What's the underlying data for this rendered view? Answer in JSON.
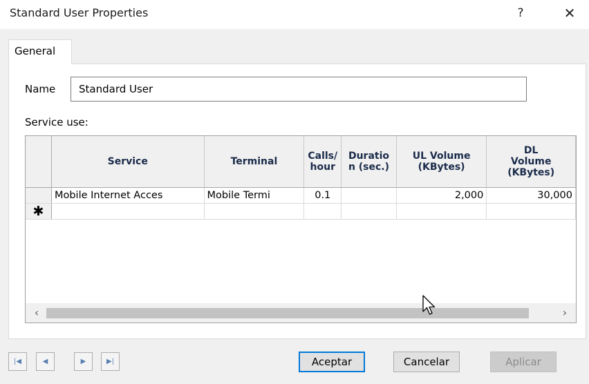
{
  "window": {
    "title": "Standard User Properties",
    "help_label": "?",
    "close_label": "✕"
  },
  "tabs": [
    {
      "label": "General",
      "selected": true
    }
  ],
  "name_field": {
    "label": "Name",
    "value": "Standard User"
  },
  "service_use": {
    "label": "Service use:",
    "columns": [
      {
        "key": "service",
        "label": "Service"
      },
      {
        "key": "terminal",
        "label": "Terminal"
      },
      {
        "key": "calls_hour",
        "label": "Calls/ hour"
      },
      {
        "key": "duration",
        "label": "Duratio n (sec.)"
      },
      {
        "key": "ul_volume",
        "label": "UL Volume (KBytes)"
      },
      {
        "key": "dl_volume",
        "label": "DL Volume (KBytes)"
      }
    ],
    "rows": [
      {
        "service": "Mobile Internet Acces",
        "terminal": "Mobile Termi",
        "calls_hour": "0.1",
        "duration": "",
        "ul_volume": "2,000",
        "dl_volume": "30,000"
      }
    ],
    "new_row_marker": "✱",
    "scroll_left_icon": "‹",
    "scroll_right_icon": "›"
  },
  "navigator": {
    "first_icon": "|◀",
    "prev_icon": "◀",
    "next_icon": "▶",
    "last_icon": "▶|"
  },
  "buttons": {
    "ok": "Aceptar",
    "cancel": "Cancelar",
    "apply": "Aplicar",
    "apply_enabled": false
  },
  "colors": {
    "accent": "#0078d7",
    "header_text": "#1a2b4a",
    "navigator_icon": "#5a7fb0"
  }
}
